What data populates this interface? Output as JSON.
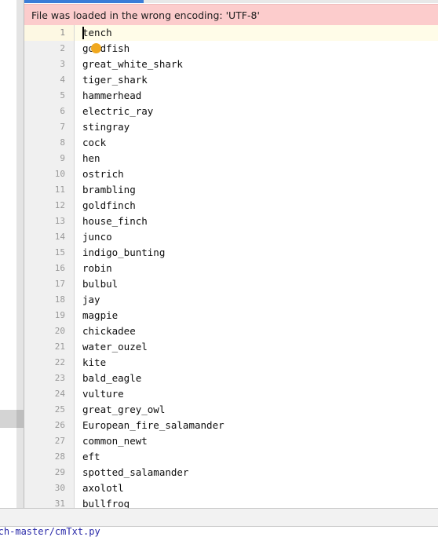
{
  "notification": {
    "message": "File was loaded in the wrong encoding: 'UTF-8'",
    "background_color": "#fccccc",
    "text_color": "#1d1d1d"
  },
  "accent": {
    "tab_bar_color": "#3b7dd8",
    "tab_bar_track_color": "#e8e8e8"
  },
  "editor": {
    "current_line": 1,
    "current_line_background": "#fffce8",
    "gutter_background": "#f0f0f0",
    "lines": [
      {
        "number": "1",
        "text": "tench"
      },
      {
        "number": "2",
        "text": "goldfish"
      },
      {
        "number": "3",
        "text": "great_white_shark"
      },
      {
        "number": "4",
        "text": "tiger_shark"
      },
      {
        "number": "5",
        "text": "hammerhead"
      },
      {
        "number": "6",
        "text": "electric_ray"
      },
      {
        "number": "7",
        "text": "stingray"
      },
      {
        "number": "8",
        "text": "cock"
      },
      {
        "number": "9",
        "text": "hen"
      },
      {
        "number": "10",
        "text": "ostrich"
      },
      {
        "number": "11",
        "text": "brambling"
      },
      {
        "number": "12",
        "text": "goldfinch"
      },
      {
        "number": "13",
        "text": "house_finch"
      },
      {
        "number": "14",
        "text": "junco"
      },
      {
        "number": "15",
        "text": "indigo_bunting"
      },
      {
        "number": "16",
        "text": "robin"
      },
      {
        "number": "17",
        "text": "bulbul"
      },
      {
        "number": "18",
        "text": "jay"
      },
      {
        "number": "19",
        "text": "magpie"
      },
      {
        "number": "20",
        "text": "chickadee"
      },
      {
        "number": "21",
        "text": "water_ouzel"
      },
      {
        "number": "22",
        "text": "kite"
      },
      {
        "number": "23",
        "text": "bald_eagle"
      },
      {
        "number": "24",
        "text": "vulture"
      },
      {
        "number": "25",
        "text": "great_grey_owl"
      },
      {
        "number": "26",
        "text": "European_fire_salamander"
      },
      {
        "number": "27",
        "text": "common_newt"
      },
      {
        "number": "28",
        "text": "eft"
      },
      {
        "number": "29",
        "text": "spotted_salamander"
      },
      {
        "number": "30",
        "text": "axolotl"
      },
      {
        "number": "31",
        "text": "bullfrog"
      }
    ]
  },
  "status_bar": {
    "file_path": "torch-master/cmTxt.py",
    "path_color": "#2828a8"
  },
  "pointer": {
    "icon": "mouse-cursor-dot",
    "color": "#f0a81e"
  }
}
